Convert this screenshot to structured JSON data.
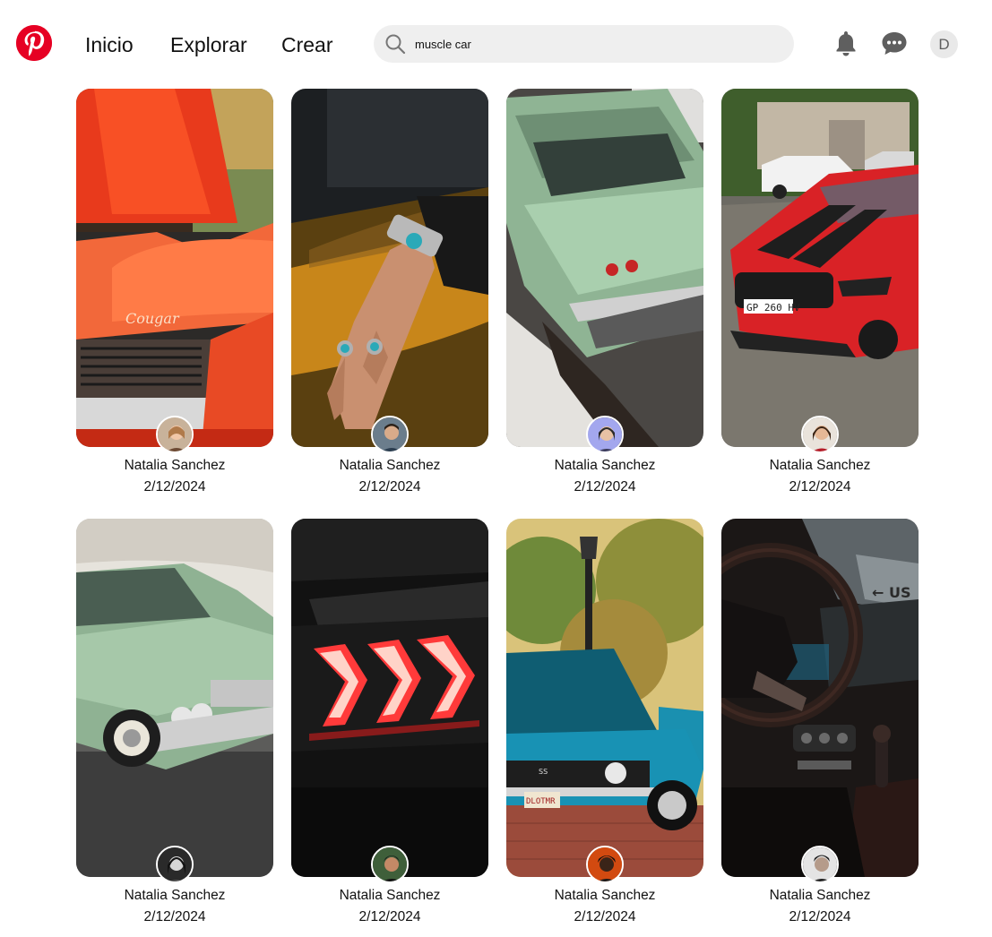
{
  "header": {
    "logo_icon": "pinterest-logo-icon",
    "nav": [
      {
        "label": "Inicio"
      },
      {
        "label": "Explorar"
      },
      {
        "label": "Crear"
      }
    ],
    "search": {
      "icon": "search-icon",
      "value": "muscle car"
    },
    "notifications_icon": "bell-icon",
    "messages_icon": "chat-icon",
    "user_initial": "D"
  },
  "pins": [
    {
      "author": "Natalia Sanchez",
      "date": "2/12/2024",
      "image": "orange Cougar muscle car with open hood"
    },
    {
      "author": "Natalia Sanchez",
      "date": "2/12/2024",
      "image": "hand with turquoise rings over car"
    },
    {
      "author": "Natalia Sanchez",
      "date": "2/12/2024",
      "image": "green classic car tail fin"
    },
    {
      "author": "Natalia Sanchez",
      "date": "2/12/2024",
      "image": "red Mustang Shelby with black stripes"
    },
    {
      "author": "Natalia Sanchez",
      "date": "2/12/2024",
      "image": "green classic car front"
    },
    {
      "author": "Natalia Sanchez",
      "date": "2/12/2024",
      "image": "red Mustang tail lights"
    },
    {
      "author": "Natalia Sanchez",
      "date": "2/12/2024",
      "image": "blue Camaro with open hood under street lamp"
    },
    {
      "author": "Natalia Sanchez",
      "date": "2/12/2024",
      "image": "dark car interior steering wheel"
    }
  ],
  "colors": {
    "brand": "#e60023",
    "search_bg": "#efefef"
  }
}
